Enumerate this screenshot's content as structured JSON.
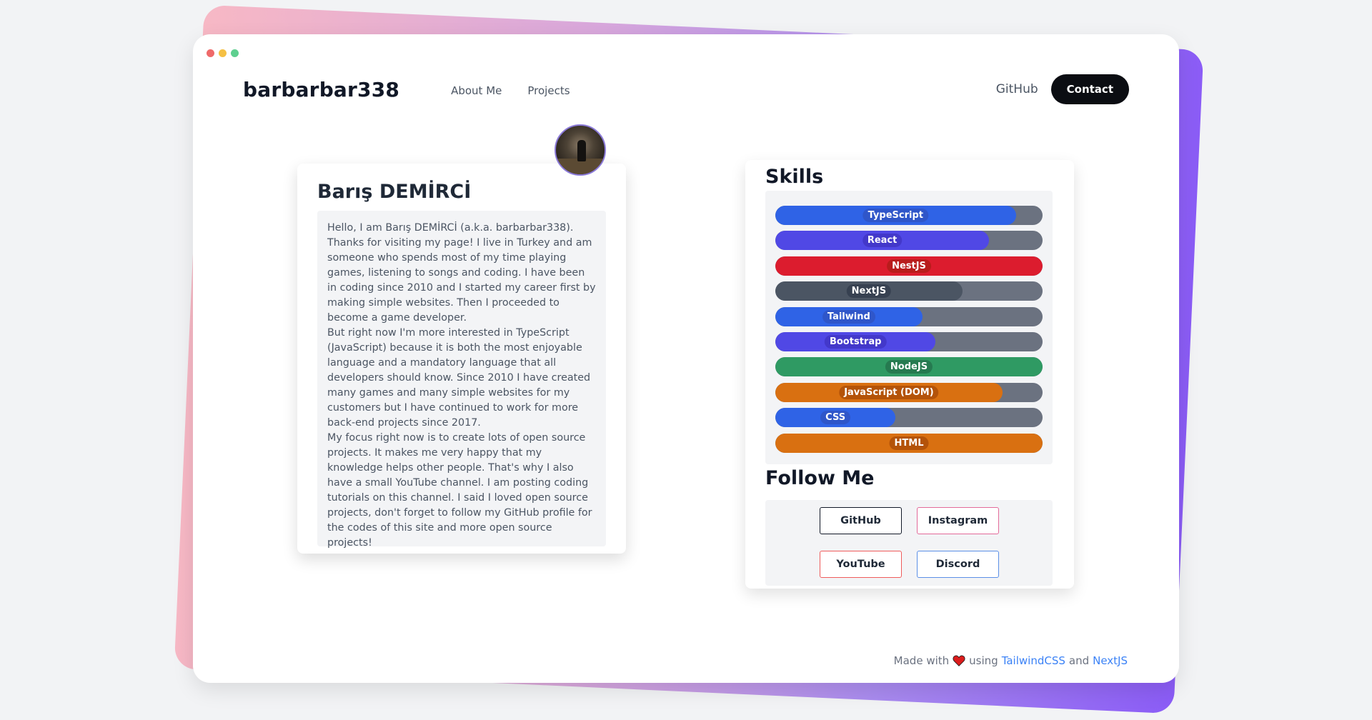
{
  "nav": {
    "brand": "barbarbar338",
    "links": [
      "About Me",
      "Projects"
    ],
    "github": "GitHub",
    "contact": "Contact"
  },
  "about": {
    "title": "Barış DEMİRCİ",
    "paragraphs": [
      "Hello, I am Barış DEMİRCİ (a.k.a. barbarbar338). Thanks for visiting my page! I live in Turkey and am someone who spends most of my time playing games, listening to songs and coding. I have been in coding since 2010 and I started my career first by making simple websites. Then I proceeded to become a game developer.",
      "But right now I'm more interested in TypeScript (JavaScript) because it is both the most enjoyable language and a mandatory language that all developers should know. Since 2010 I have created many games and many simple websites for my customers but I have continued to work for more back-end projects since 2017.",
      "My focus right now is to create lots of open source projects. It makes me very happy that my knowledge helps other people. That's why I also have a small YouTube channel. I am posting coding tutorials on this channel. I said I loved open source projects, don't forget to follow my GitHub profile for the codes of this site and more open source projects!"
    ]
  },
  "skills": {
    "title": "Skills",
    "items": [
      {
        "name": "TypeScript",
        "level": 90,
        "color": "#2f63e6",
        "label_bg": "#2f56c9"
      },
      {
        "name": "React",
        "level": 80,
        "color": "#5048e5",
        "label_bg": "#4338ca"
      },
      {
        "name": "NestJS",
        "level": 100,
        "color": "#dc1c2e",
        "label_bg": "#b91c1c"
      },
      {
        "name": "NextJS",
        "level": 70,
        "color": "#4b5563",
        "label_bg": "#374151"
      },
      {
        "name": "Tailwind",
        "level": 55,
        "color": "#2f63e6",
        "label_bg": "#2f56c9"
      },
      {
        "name": "Bootstrap",
        "level": 60,
        "color": "#5048e5",
        "label_bg": "#4338ca"
      },
      {
        "name": "NodeJS",
        "level": 100,
        "color": "#2f9a63",
        "label_bg": "#267a50"
      },
      {
        "name": "JavaScript (DOM)",
        "level": 85,
        "color": "#d97011",
        "label_bg": "#b45309"
      },
      {
        "name": "CSS",
        "level": 45,
        "color": "#2f63e6",
        "label_bg": "#2f56c9"
      },
      {
        "name": "HTML",
        "level": 100,
        "color": "#d97011",
        "label_bg": "#b45309"
      }
    ]
  },
  "follow": {
    "title": "Follow Me",
    "buttons": [
      {
        "label": "GitHub",
        "border": "#111827"
      },
      {
        "label": "Instagram",
        "border": "#e36a9a"
      },
      {
        "label": "YouTube",
        "border": "#ef5b5b"
      },
      {
        "label": "Discord",
        "border": "#5b8fe6"
      }
    ]
  },
  "footer": {
    "prefix": "Made with",
    "mid": "using",
    "link1": "TailwindCSS",
    "and": "and",
    "link2": "NextJS"
  }
}
